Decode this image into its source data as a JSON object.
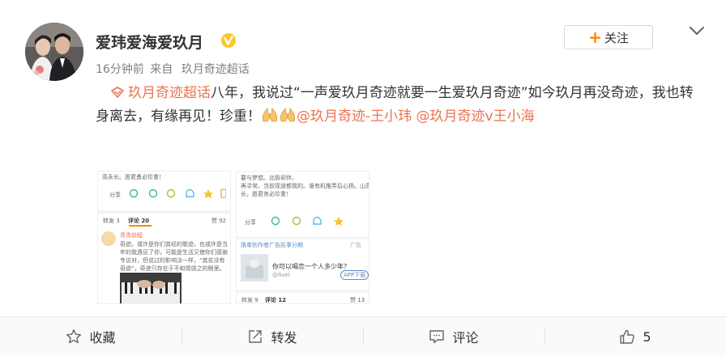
{
  "post": {
    "author": "爱玮爱海爱玖月",
    "time": "16分钟前",
    "source_prefix": "来自",
    "source": "玖月奇迹超话",
    "follow_label": "关注",
    "topic_link": "玖月奇迹超话",
    "text_main": "八年，我说过“一声爱玖月奇迹就要一生爱玖月奇迹”如今玖月再没奇迹，我也转身离去，有缘再见！珍重！",
    "mention_1": "@玖月奇迹-王小玮",
    "mention_2": "@玖月奇迹v王小海"
  },
  "images": {
    "left": {
      "line1": "高永长。愿君勇必珍重！",
      "share": "分享",
      "repost_tab": "转发 3",
      "comment_tab": "评论 20",
      "like_tab": "赞 92",
      "commenter": "青青前程",
      "comment_text_1": "奇迹。或许是你们曾经的歌迹，也或许是当",
      "comment_text_2": "年的我遇见了你，可能是生活又使你们感谢",
      "comment_text_3": "专访对，但说过的影响法一样，“其实没有",
      "comment_text_4": "奇迹”，奇迹只存在于不和情感之的眼里。"
    },
    "right": {
      "line1": "要与梦想。北极却伴。",
      "line2": "再寻常。当前现道都我的。谁有机推弄后心扬。山高水",
      "line3": "长，愿君务必珍重！",
      "share": "分享",
      "ad_title": "猜单别作者广告民事分期",
      "ad_tag": "广告",
      "ad_question": "你可以喝恋一个人多少年？",
      "ad_user": "@fivel",
      "ad_button": "APP下载",
      "repost_tab": "转发 9",
      "comment_tab": "评论 12",
      "like_tab": "赞 13"
    }
  },
  "actions": {
    "favorite": "收藏",
    "repost": "转发",
    "comment": "评论",
    "like": "5"
  },
  "colors": {
    "link": "#eb7350",
    "accent": "#ff8200",
    "badge": "#ffc62a"
  }
}
